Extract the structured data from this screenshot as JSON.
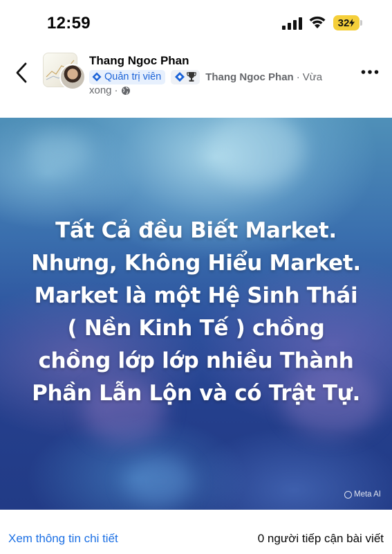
{
  "status_bar": {
    "time": "12:59",
    "battery": "32"
  },
  "post": {
    "author": "Thang Ngoc Phan",
    "role_badge": "Quản trị viên",
    "author_repeat": "Thang Ngoc Phan",
    "separator": "·",
    "time_part1": "Vừa",
    "time_part2": "xong",
    "privacy": "public"
  },
  "image": {
    "caption_lines": [
      "Tất Cả đều Biết Market.",
      "Nhưng, Không Hiểu Market.",
      "Market là một Hệ Sinh Thái",
      "( Nền Kinh Tế ) chồng",
      "chồng lớp lớp nhiều Thành",
      "Phần Lẫn Lộn và có Trật Tự."
    ],
    "watermark": "Meta AI"
  },
  "footer": {
    "details_link": "Xem thông tin chi tiết",
    "reach": "0 người tiếp cận bài viết"
  },
  "colors": {
    "accent": "#1b6fe4",
    "battery": "#f5cf3a",
    "admin_bg": "#e7f0fd"
  },
  "icons": [
    "signal-icon",
    "wifi-icon",
    "back-icon",
    "admin-diamond-icon",
    "trophy-icon",
    "globe-icon",
    "more-icon"
  ]
}
